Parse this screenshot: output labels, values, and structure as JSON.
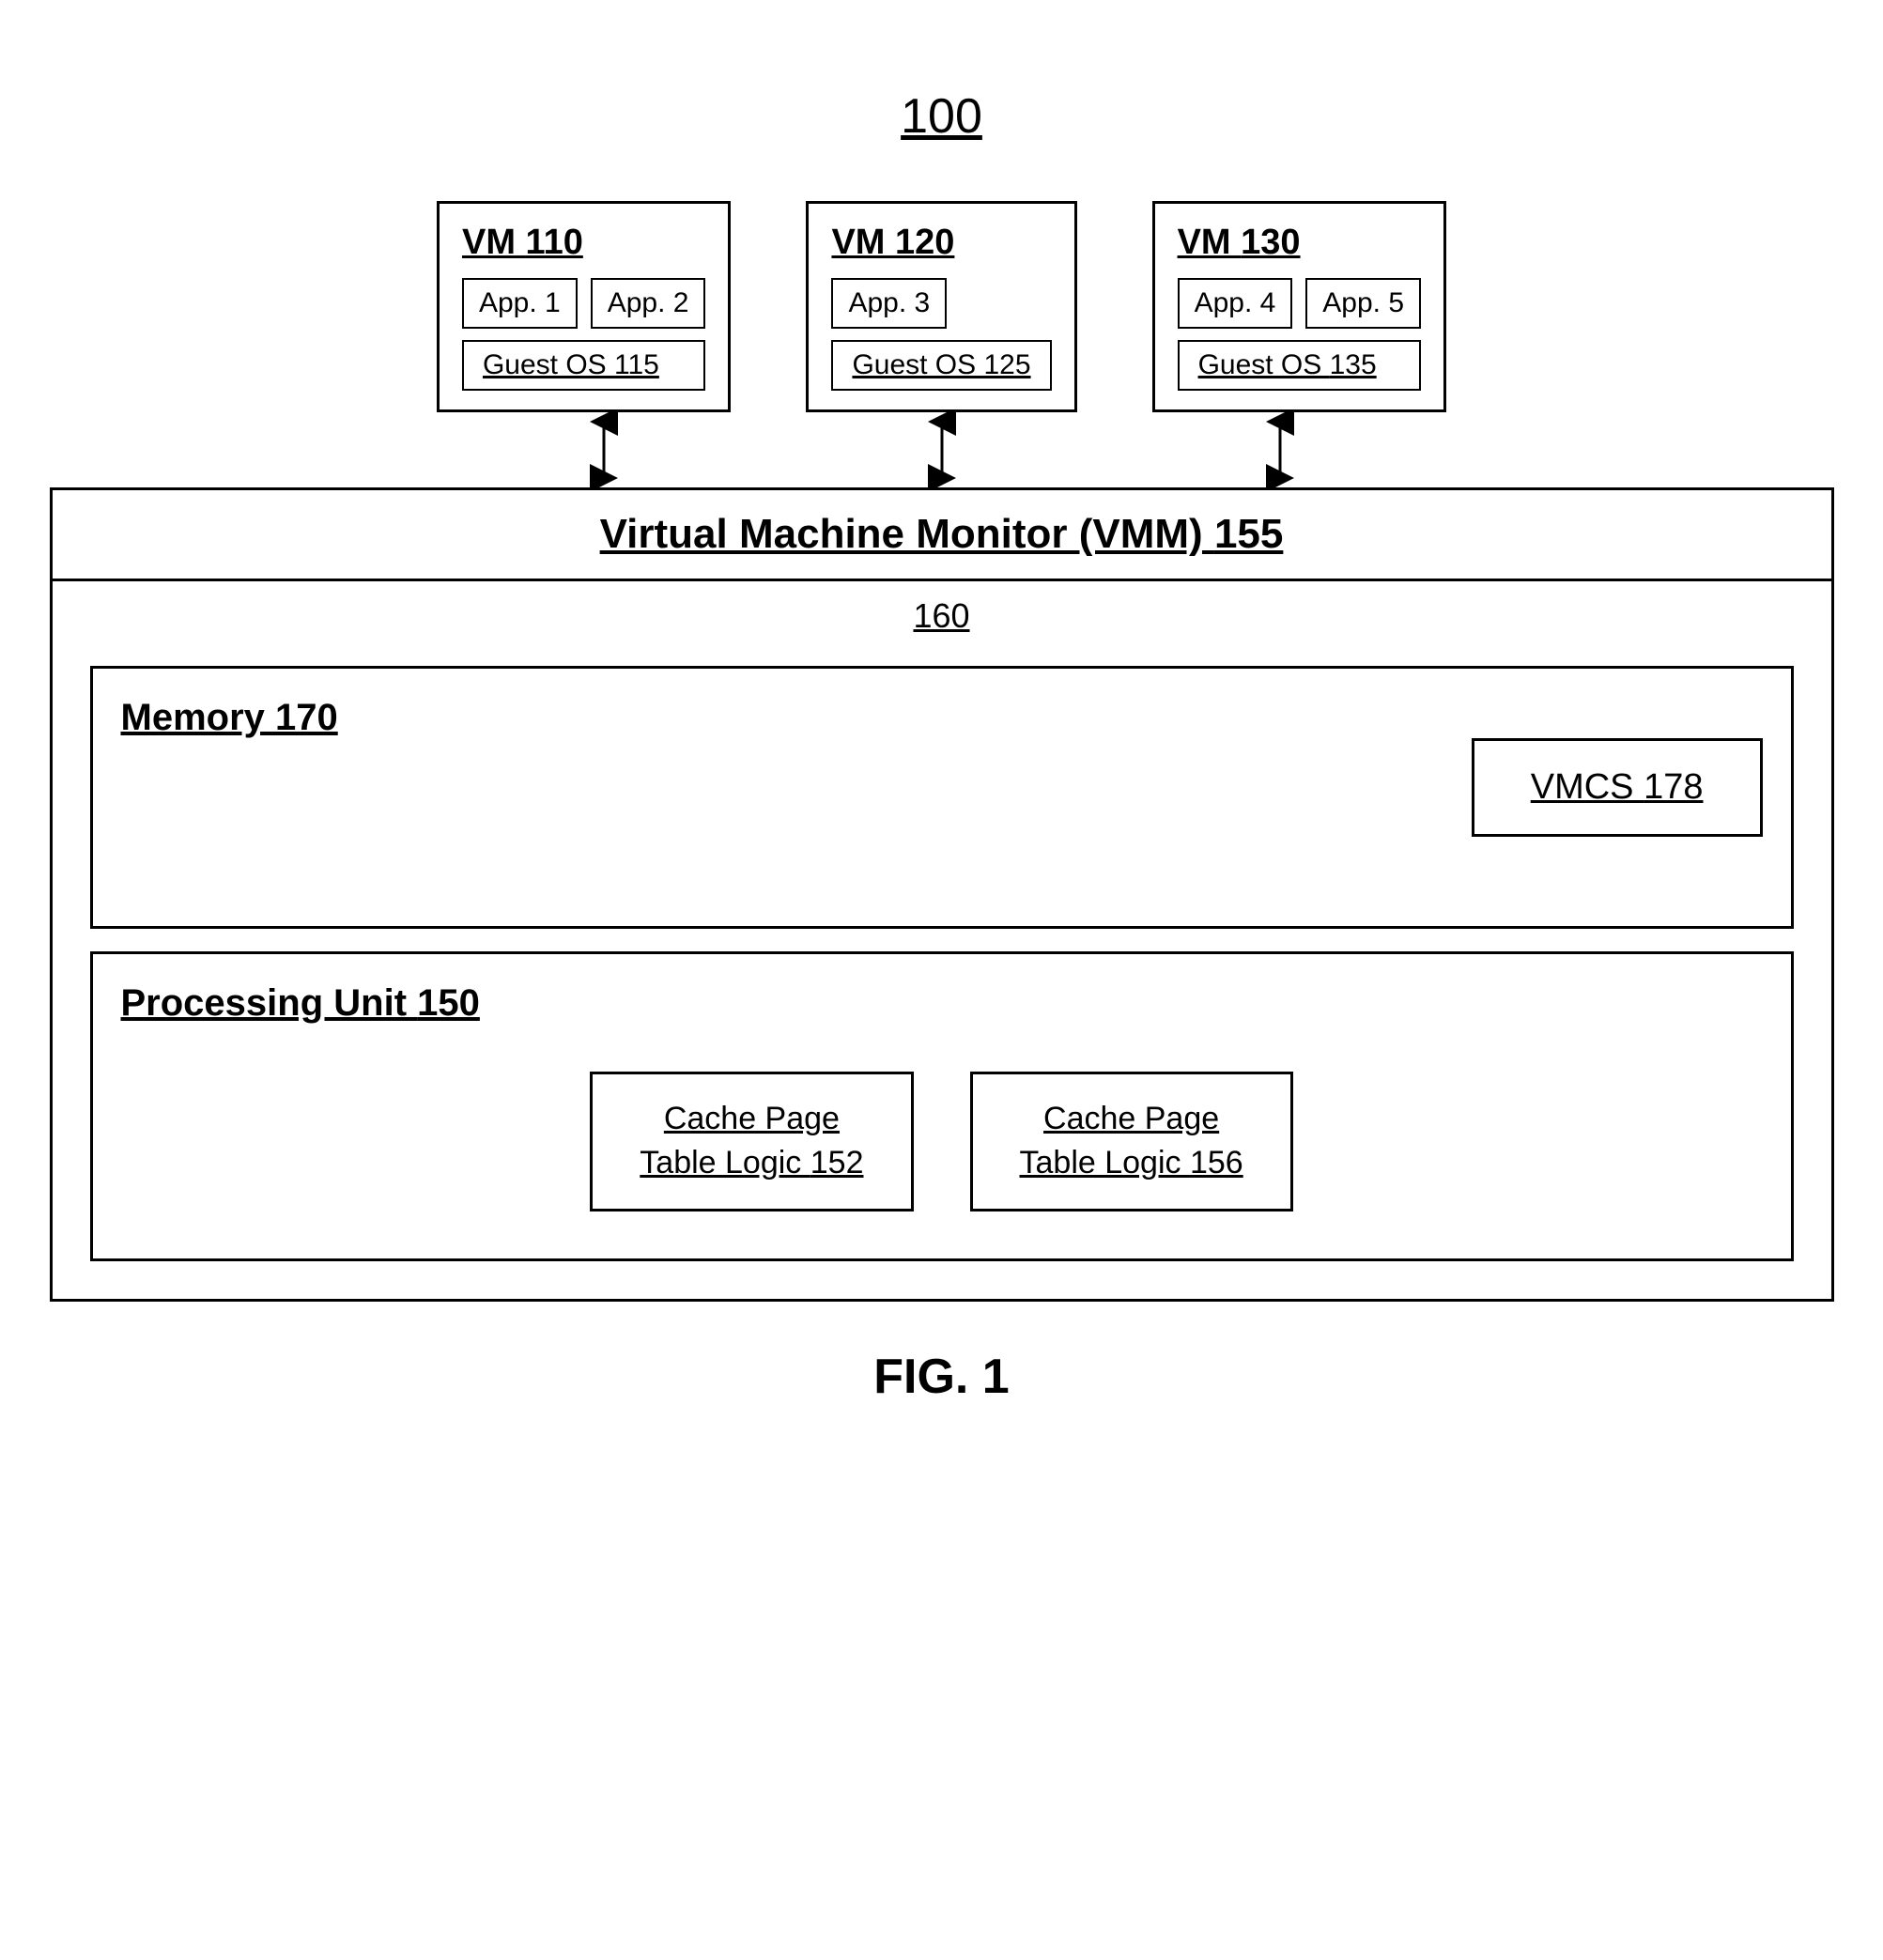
{
  "diagram": {
    "top_label": "100",
    "vms": [
      {
        "id": "vm110",
        "title": "VM ",
        "title_num": "110",
        "apps": [
          "App. 1",
          "App. 2"
        ],
        "guest_os": "Guest OS ",
        "guest_os_num": "115"
      },
      {
        "id": "vm120",
        "title": "VM ",
        "title_num": "120",
        "apps": [
          "App. 3"
        ],
        "guest_os": "Guest OS ",
        "guest_os_num": "125"
      },
      {
        "id": "vm130",
        "title": "VM ",
        "title_num": "130",
        "apps": [
          "App. 4",
          "App. 5"
        ],
        "guest_os": "Guest OS ",
        "guest_os_num": "135"
      }
    ],
    "vmm": {
      "label": "Virtual Machine Monitor (VMM) ",
      "label_num": "155"
    },
    "hardware_label": "160",
    "memory": {
      "title": "Memory ",
      "title_num": "170",
      "vmcs_label": "VMCS ",
      "vmcs_num": "178"
    },
    "processing": {
      "title": "Processing Unit ",
      "title_num": "150",
      "cache_boxes": [
        {
          "line1": "Cache Page",
          "line2": "Table Logic ",
          "num": "152"
        },
        {
          "line1": "Cache Page",
          "line2": "Table Logic ",
          "num": "156"
        }
      ]
    },
    "fig_label": "FIG. 1"
  }
}
